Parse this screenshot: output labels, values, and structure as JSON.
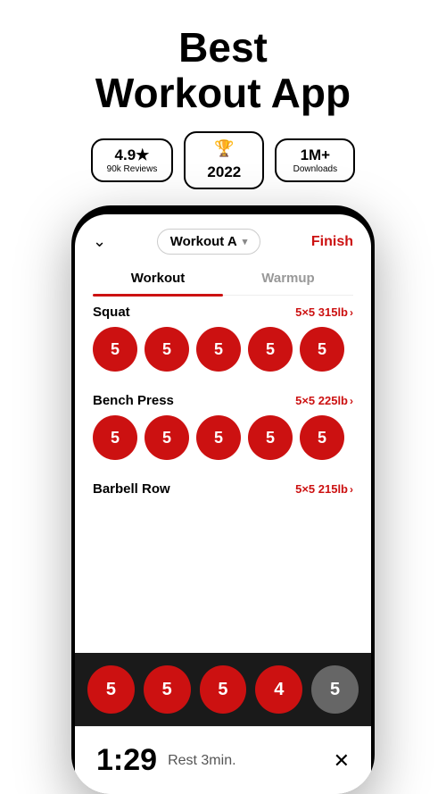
{
  "header": {
    "title_line1": "Best",
    "title_line2": "Workout App"
  },
  "badges": [
    {
      "id": "rating",
      "main": "4.9★",
      "sub": "90k Reviews"
    },
    {
      "id": "award",
      "icon": "🏆",
      "main": "2022"
    },
    {
      "id": "downloads",
      "main": "1M+",
      "sub": "Downloads"
    }
  ],
  "app": {
    "chevron": "∨",
    "workout_name": "Workout A",
    "finish_label": "Finish",
    "tabs": [
      {
        "id": "workout",
        "label": "Workout",
        "active": true
      },
      {
        "id": "warmup",
        "label": "Warmup",
        "active": false
      }
    ],
    "exercises": [
      {
        "name": "Squat",
        "sets_label": "5×5 315lb",
        "reps": [
          5,
          5,
          5,
          5,
          5
        ]
      },
      {
        "name": "Bench Press",
        "sets_label": "5×5 225lb",
        "reps": [
          5,
          5,
          5,
          5,
          5
        ]
      },
      {
        "name": "Barbell Row",
        "sets_label": "5×5 215lb",
        "reps": [
          5,
          5,
          5,
          4,
          5
        ]
      }
    ],
    "bottom_circles": [
      5,
      5,
      5,
      4
    ],
    "bottom_gray_circle": 5,
    "rest_time": "1:29",
    "rest_label": "Rest 3min.",
    "close_icon": "✕"
  }
}
